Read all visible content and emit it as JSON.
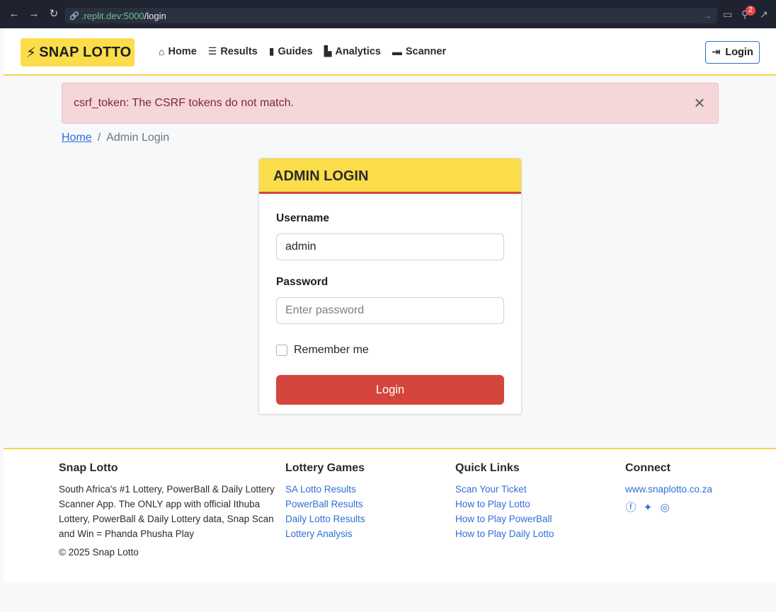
{
  "browser": {
    "url_host": ".replit.dev:5000",
    "url_path": "/login",
    "notification_count": "2"
  },
  "navbar": {
    "brand": "SNAP LOTTO",
    "links": [
      {
        "label": "Home",
        "icon": "home-icon"
      },
      {
        "label": "Results",
        "icon": "list-ordered-icon"
      },
      {
        "label": "Guides",
        "icon": "book-icon"
      },
      {
        "label": "Analytics",
        "icon": "chart-icon"
      },
      {
        "label": "Scanner",
        "icon": "ticket-icon"
      }
    ],
    "login_label": "Login"
  },
  "alert": {
    "message": "csrf_token: The CSRF tokens do not match."
  },
  "breadcrumb": {
    "home": "Home",
    "separator": "/",
    "current": "Admin Login"
  },
  "login_card": {
    "title": "ADMIN LOGIN",
    "username_label": "Username",
    "username_value": "admin",
    "password_label": "Password",
    "password_placeholder": "Enter password",
    "remember_label": "Remember me",
    "submit_label": "Login"
  },
  "footer": {
    "about_title": "Snap Lotto",
    "about_text": "South Africa's #1 Lottery, PowerBall & Daily Lottery Scanner App. The ONLY app with official Ithuba Lottery, PowerBall & Daily Lottery data, Snap Scan and Win = Phanda Phusha Play",
    "copyright": "© 2025 Snap Lotto",
    "games_title": "Lottery Games",
    "games": [
      "SA Lotto Results",
      "PowerBall Results",
      "Daily Lotto Results",
      "Lottery Analysis"
    ],
    "quick_title": "Quick Links",
    "quick": [
      "Scan Your Ticket",
      "How to Play Lotto",
      "How to Play PowerBall",
      "How to Play Daily Lotto"
    ],
    "connect_title": "Connect",
    "website": "www.snaplotto.co.za",
    "social_icons": [
      "facebook-icon",
      "twitter-icon",
      "instagram-icon"
    ]
  },
  "colors": {
    "brand_yellow": "#fbdd4a",
    "accent_red": "#d4463d",
    "link_blue": "#2f6fd6",
    "alert_bg": "#f5d6d9"
  }
}
